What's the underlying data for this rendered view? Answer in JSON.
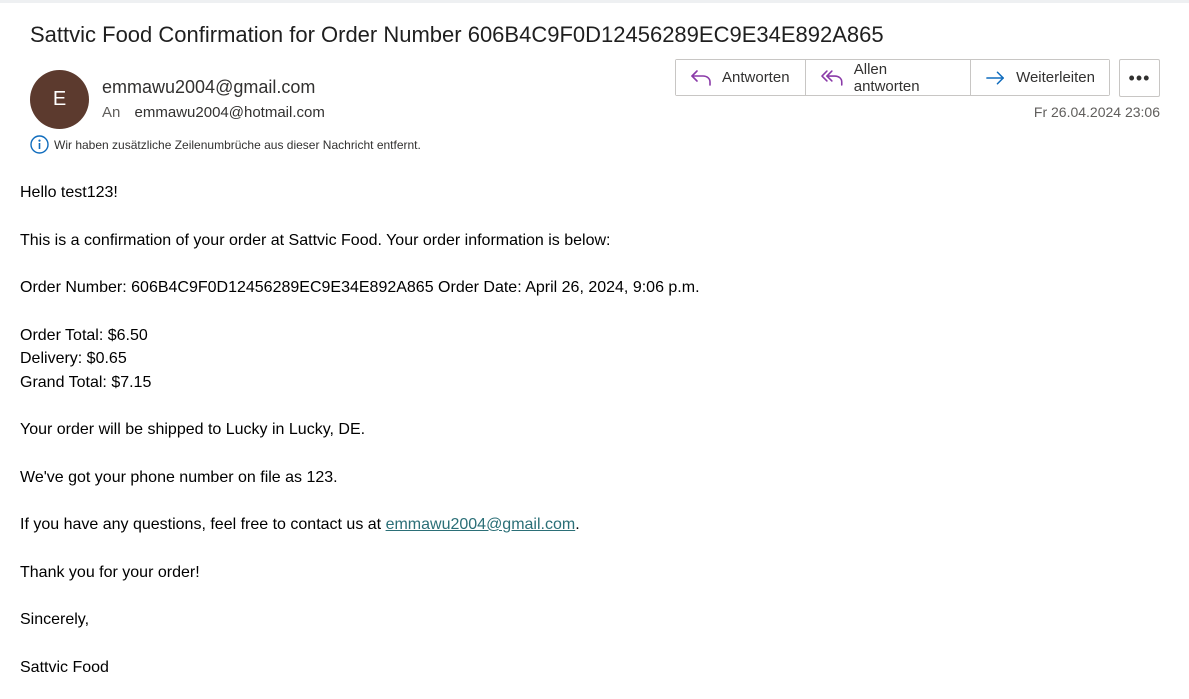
{
  "email": {
    "subject": "Sattvic Food Confirmation for Order Number 606B4C9F0D12456289EC9E34E892A865",
    "avatar_initial": "E",
    "avatar_color": "#5c3a2e",
    "sender": "emmawu2004@gmail.com",
    "to_label": "An",
    "to_address": "emmawu2004@hotmail.com",
    "date": "Fr 26.04.2024 23:06",
    "info_notice": "Wir haben zusätzliche Zeilenumbrüche aus dieser Nachricht entfernt."
  },
  "toolbar": {
    "reply_label": "Antworten",
    "reply_all_label": "Allen antworten",
    "forward_label": "Weiterleiten",
    "more_label": "•••"
  },
  "body": {
    "greeting": "Hello test123!",
    "intro": "This is a confirmation of your order at Sattvic Food. Your order information is below:",
    "order_line": "Order Number: 606B4C9F0D12456289EC9E34E892A865 Order Date: April 26, 2024, 9:06 p.m.",
    "order_total": "Order Total: $6.50",
    "delivery": "Delivery: $0.65",
    "grand_total": "Grand Total: $7.15",
    "shipping": "Your order will be shipped to Lucky in Lucky, DE.",
    "phone": "We've got your phone number on file as 123.",
    "questions_prefix": "If you have any questions, feel free to contact us at ",
    "contact_email": "emmawu2004@gmail.com",
    "questions_suffix": ".",
    "thanks": "Thank you for your order!",
    "closing": "Sincerely,",
    "signature": "Sattvic Food"
  },
  "colors": {
    "reply_icon": "#8a3aa8",
    "forward_icon": "#0f6cbd",
    "link": "#2b6f77",
    "info_icon": "#0f6cbd"
  },
  "icons": {
    "reply": "reply-icon",
    "reply_all": "reply-all-icon",
    "forward": "forward-icon",
    "more": "more-icon",
    "info": "info-icon"
  }
}
